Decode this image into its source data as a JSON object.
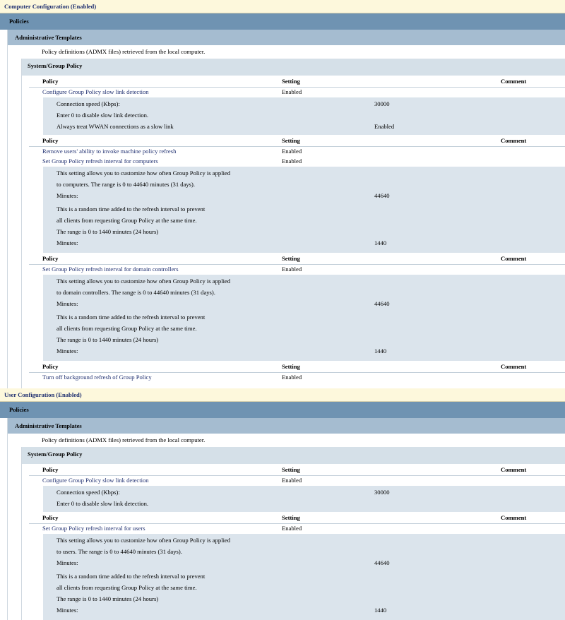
{
  "computer": {
    "title": "Computer Configuration (Enabled)",
    "policies_label": "Policies",
    "admin_templates_label": "Administrative Templates",
    "admx_desc": "Policy definitions (ADMX files) retrieved from the local computer.",
    "category": "System/Group Policy",
    "groups": [
      {
        "header": {
          "policy": "Policy",
          "setting": "Setting",
          "comment": "Comment"
        },
        "rows": [
          {
            "name": "Configure Group Policy slow link detection",
            "state": "Enabled"
          }
        ],
        "details": [
          {
            "label": "Connection speed (Kbps):",
            "value": "30000"
          },
          {
            "label": "Enter 0 to disable slow link detection.",
            "value": ""
          },
          {
            "label": "Always treat WWAN connections as a slow link",
            "value": "Enabled"
          }
        ]
      },
      {
        "header": {
          "policy": "Policy",
          "setting": "Setting",
          "comment": "Comment"
        },
        "rows": [
          {
            "name": "Remove users' ability to invoke machine policy refresh",
            "state": "Enabled"
          },
          {
            "name": "Set Group Policy refresh interval for computers",
            "state": "Enabled"
          }
        ],
        "details": [
          {
            "label": "This setting allows you to customize how often Group Policy is applied",
            "value": ""
          },
          {
            "label": "to computers. The range is 0 to 44640 minutes (31 days).",
            "value": ""
          },
          {
            "label": "Minutes:",
            "value": "44640"
          },
          {
            "label": "This is a random time added to the refresh interval to prevent",
            "value": ""
          },
          {
            "label": "all clients from requesting Group Policy at the same time.",
            "value": ""
          },
          {
            "label": "The range is 0 to 1440 minutes (24 hours)",
            "value": ""
          },
          {
            "label": "Minutes:",
            "value": "1440"
          }
        ]
      },
      {
        "header": {
          "policy": "Policy",
          "setting": "Setting",
          "comment": "Comment"
        },
        "rows": [
          {
            "name": "Set Group Policy refresh interval for domain controllers",
            "state": "Enabled"
          }
        ],
        "details": [
          {
            "label": "This setting allows you to customize how often Group Policy is applied",
            "value": ""
          },
          {
            "label": "to domain controllers. The range is 0 to 44640 minutes (31 days).",
            "value": ""
          },
          {
            "label": "Minutes:",
            "value": "44640"
          },
          {
            "label": "This is a random time added to the refresh interval to prevent",
            "value": ""
          },
          {
            "label": "all clients from requesting Group Policy at the same time.",
            "value": ""
          },
          {
            "label": "The range is 0 to 1440 minutes (24 hours)",
            "value": ""
          },
          {
            "label": "Minutes:",
            "value": "1440"
          }
        ]
      },
      {
        "header": {
          "policy": "Policy",
          "setting": "Setting",
          "comment": "Comment"
        },
        "rows": [
          {
            "name": "Turn off background refresh of Group Policy",
            "state": "Enabled"
          }
        ],
        "details": []
      }
    ]
  },
  "user": {
    "title": "User Configuration (Enabled)",
    "policies_label": "Policies",
    "admin_templates_label": "Administrative Templates",
    "admx_desc": "Policy definitions (ADMX files) retrieved from the local computer.",
    "category": "System/Group Policy",
    "groups": [
      {
        "header": {
          "policy": "Policy",
          "setting": "Setting",
          "comment": "Comment"
        },
        "rows": [
          {
            "name": "Configure Group Policy slow link detection",
            "state": "Enabled"
          }
        ],
        "details": [
          {
            "label": "Connection speed (Kbps):",
            "value": "30000"
          },
          {
            "label": "Enter 0 to disable slow link detection.",
            "value": ""
          }
        ]
      },
      {
        "header": {
          "policy": "Policy",
          "setting": "Setting",
          "comment": "Comment"
        },
        "rows": [
          {
            "name": "Set Group Policy refresh interval for users",
            "state": "Enabled"
          }
        ],
        "details": [
          {
            "label": "This setting allows you to customize how often Group Policy is applied",
            "value": ""
          },
          {
            "label": "to users. The range is 0 to 44640 minutes (31 days).",
            "value": ""
          },
          {
            "label": "Minutes:",
            "value": "44640"
          },
          {
            "label": "This is a random time added to the refresh interval to prevent",
            "value": ""
          },
          {
            "label": "all clients from requesting Group Policy at the same time.",
            "value": ""
          },
          {
            "label": "The range is 0 to 1440 minutes (24 hours)",
            "value": ""
          },
          {
            "label": "Minutes:",
            "value": "1440"
          }
        ]
      }
    ]
  }
}
